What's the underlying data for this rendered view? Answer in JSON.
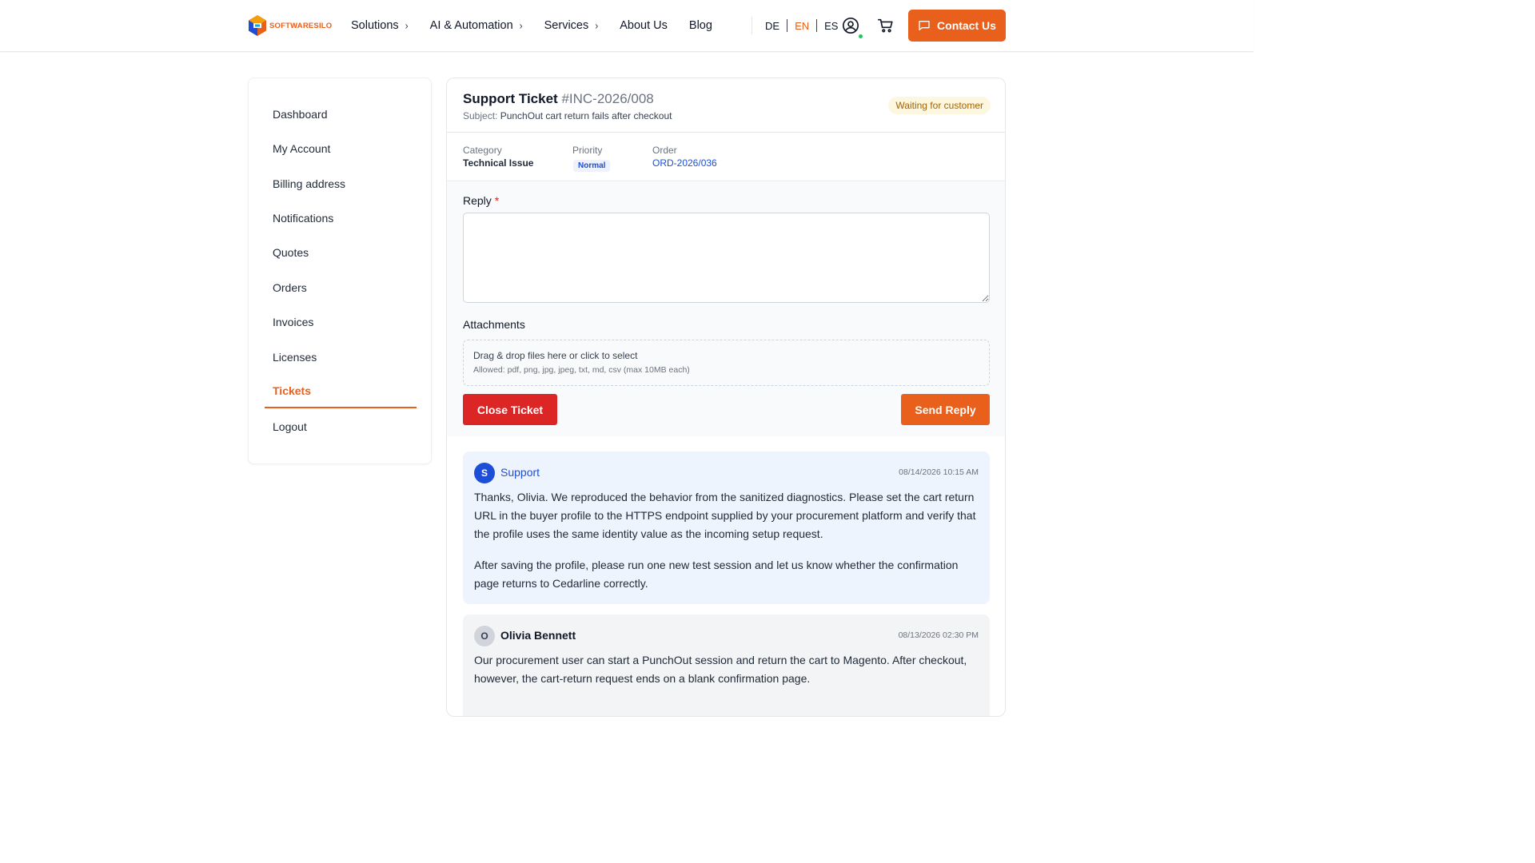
{
  "brand": {
    "name": "SOFTWARESILO",
    "accent": "#e8601c"
  },
  "nav": {
    "items": [
      {
        "label": "Solutions",
        "has_chevron": true
      },
      {
        "label": "AI & Automation",
        "has_chevron": true
      },
      {
        "label": "Services",
        "has_chevron": true
      },
      {
        "label": "About Us",
        "has_chevron": false
      },
      {
        "label": "Blog",
        "has_chevron": false
      }
    ],
    "languages": [
      "DE",
      "EN",
      "ES"
    ],
    "active_language": "EN",
    "contact_label": "Contact Us"
  },
  "sidebar": {
    "items": [
      {
        "label": "Dashboard"
      },
      {
        "label": "My Account"
      },
      {
        "label": "Billing address"
      },
      {
        "label": "Notifications"
      },
      {
        "label": "Quotes"
      },
      {
        "label": "Orders"
      },
      {
        "label": "Invoices"
      },
      {
        "label": "Licenses"
      },
      {
        "label": "Tickets",
        "active": true
      },
      {
        "label": "Logout"
      }
    ]
  },
  "ticket": {
    "title": "Support Ticket",
    "id": "#INC-2026/008",
    "subject_label": "Subject:",
    "subject": "PunchOut cart return fails after checkout",
    "status": "Waiting for customer",
    "category_label": "Category",
    "category": "Technical Issue",
    "priority_label": "Priority",
    "priority": "Normal",
    "order_label": "Order",
    "order": "ORD-2026/036"
  },
  "reply": {
    "label": "Reply",
    "required_mark": "*",
    "value": "",
    "attachments_label": "Attachments",
    "drop_main": "Drag & drop files here or click to select",
    "drop_sub": "Allowed: pdf, png, jpg, jpeg, txt, md, csv (max 10MB each)",
    "close_label": "Close Ticket",
    "send_label": "Send Reply"
  },
  "messages": [
    {
      "author": "Support",
      "avatar": "S",
      "timestamp": "08/14/2026 10:15 AM",
      "paragraphs": [
        "Thanks, Olivia. We reproduced the behavior from the sanitized diagnostics. Please set the cart return URL in the buyer profile to the HTTPS endpoint supplied by your procurement platform and verify that the profile uses the same identity value as the incoming setup request.",
        "After saving the profile, please run one new test session and let us know whether the confirmation page returns to Cedarline correctly."
      ]
    },
    {
      "author": "Olivia Bennett",
      "avatar": "O",
      "timestamp": "08/13/2026 02:30 PM",
      "paragraphs": [
        "Our procurement user can start a PunchOut session and return the cart to Magento. After checkout, however, the cart-return request ends on a blank confirmation page."
      ]
    }
  ]
}
